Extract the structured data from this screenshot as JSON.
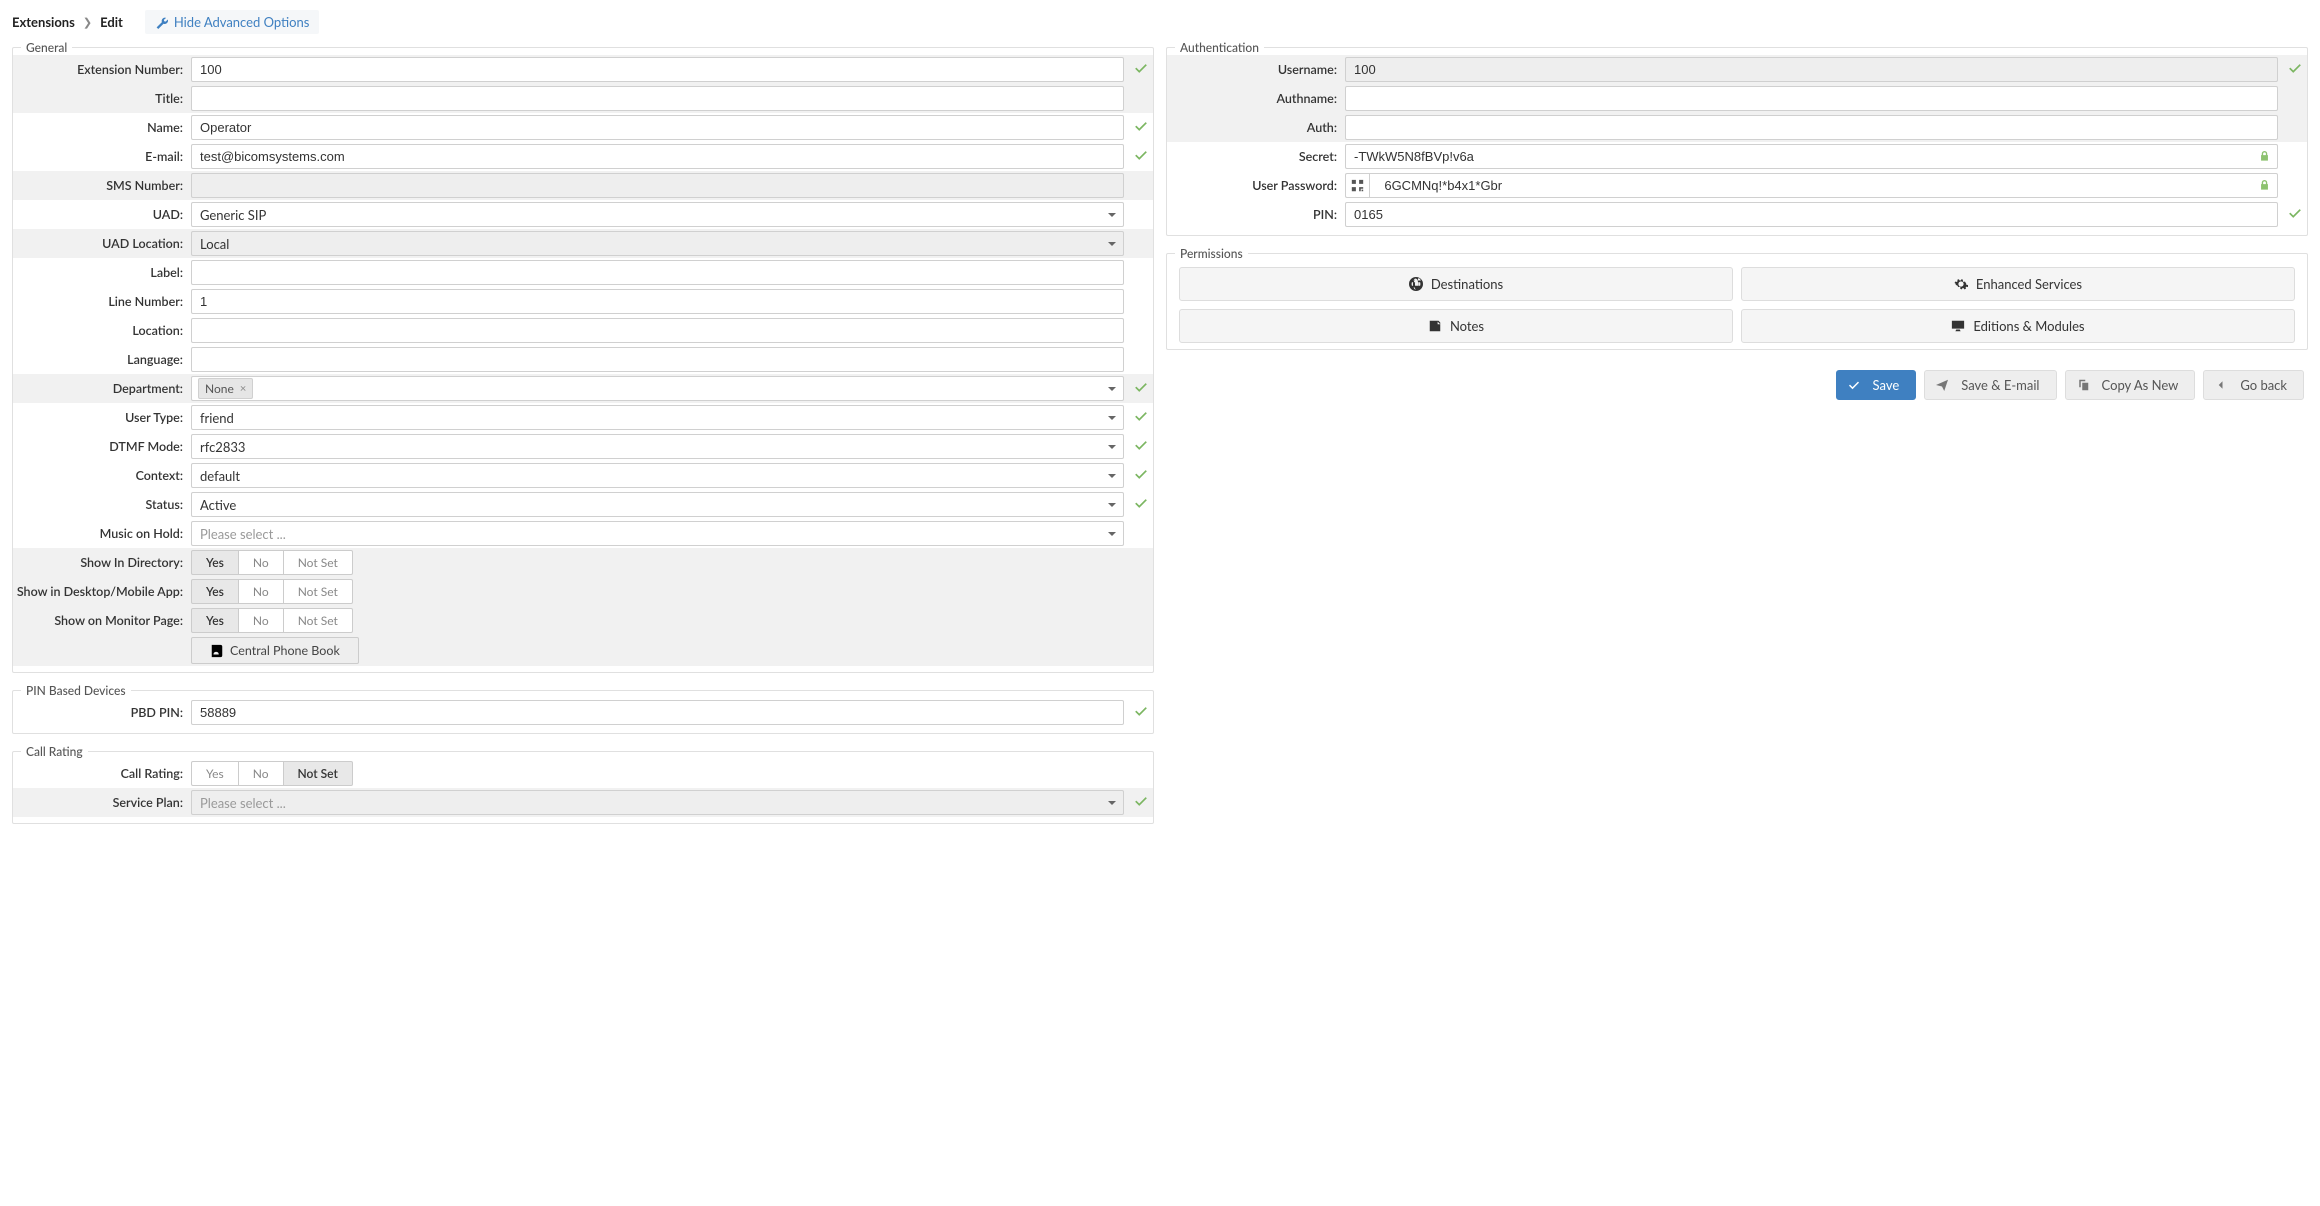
{
  "breadcrumb": {
    "root": "Extensions",
    "leaf": "Edit"
  },
  "advanced_toggle": "Hide Advanced Options",
  "general": {
    "legend": "General",
    "ext_label": "Extension Number:",
    "ext_value": "100",
    "title_label": "Title:",
    "title_value": "",
    "name_label": "Name:",
    "name_value": "Operator",
    "email_label": "E-mail:",
    "email_value": "test@bicomsystems.com",
    "sms_label": "SMS Number:",
    "sms_value": "",
    "uad_label": "UAD:",
    "uad_value": "Generic SIP",
    "uadloc_label": "UAD Location:",
    "uadloc_value": "Local",
    "label_label": "Label:",
    "label_value": "",
    "line_label": "Line Number:",
    "line_value": "1",
    "loc_label": "Location:",
    "loc_value": "",
    "lang_label": "Language:",
    "lang_value": "",
    "dept_label": "Department:",
    "dept_value": "None",
    "usertype_label": "User Type:",
    "usertype_value": "friend",
    "dtmf_label": "DTMF Mode:",
    "dtmf_value": "rfc2833",
    "ctx_label": "Context:",
    "ctx_value": "default",
    "status_label": "Status:",
    "status_value": "Active",
    "moh_label": "Music on Hold:",
    "moh_value": "Please select ...",
    "showdir_label": "Show In Directory:",
    "showapp_label": "Show in Desktop/Mobile App:",
    "showmon_label": "Show on Monitor Page:",
    "yesno": {
      "yes": "Yes",
      "no": "No",
      "notset": "Not Set"
    },
    "cpbook": "Central Phone Book"
  },
  "pin": {
    "legend": "PIN Based Devices",
    "pbd_label": "PBD PIN:",
    "pbd_value": "58889"
  },
  "rating": {
    "legend": "Call Rating",
    "callrating_label": "Call Rating:",
    "plan_label": "Service Plan:",
    "plan_value": "Please select ..."
  },
  "auth": {
    "legend": "Authentication",
    "user_label": "Username:",
    "user_value": "100",
    "authname_label": "Authname:",
    "authname_value": "",
    "auth_label": "Auth:",
    "auth_value": "",
    "secret_label": "Secret:",
    "secret_value": "-TWkW5N8fBVp!v6a",
    "pass_label": "User Password:",
    "pass_value": "6GCMNq!*b4x1*Gbr",
    "pin_label": "PIN:",
    "pin_value": "0165"
  },
  "perm": {
    "legend": "Permissions",
    "dest": "Destinations",
    "enh": "Enhanced Services",
    "notes": "Notes",
    "ed": "Editions & Modules"
  },
  "actions": {
    "save": "Save",
    "saveemail": "Save & E-mail",
    "copy": "Copy As New",
    "back": "Go back"
  }
}
